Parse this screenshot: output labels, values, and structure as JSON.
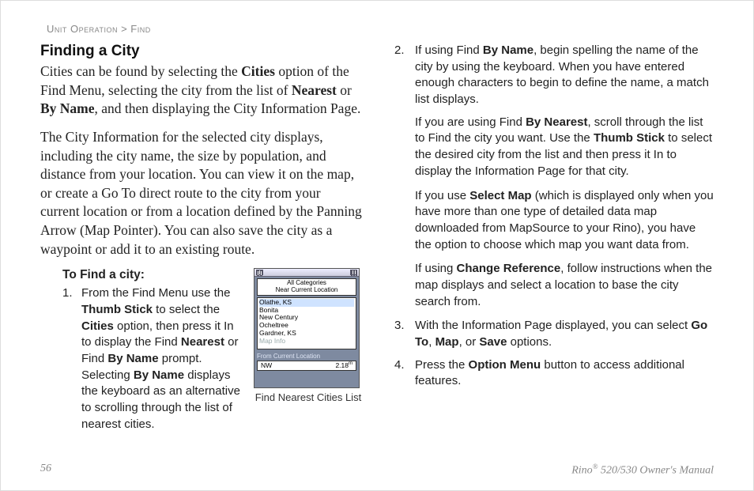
{
  "breadcrumb": {
    "section": "Unit Operation",
    "sep": ">",
    "sub": "Find"
  },
  "left": {
    "title": "Finding a City",
    "p1_a": "Cities can be found by selecting the ",
    "p1_b": "Cities",
    "p1_c": " option of the Find Menu, selecting the city from the list of ",
    "p1_d": "Nearest",
    "p1_e": " or ",
    "p1_f": "By Name",
    "p1_g": ", and then displaying the City Information Page.",
    "p2": "The City Information for the selected city displays, including the city name, the size by population, and distance from your location. You can view it on the map, or create a Go To direct route to the city from your current location or from a location defined by the Panning Arrow (Map Pointer). You can also save the city as a waypoint or add it to an existing route.",
    "steps_title": "To Find a city:",
    "step1_a": "From the Find Menu use the ",
    "step1_b": "Thumb Stick",
    "step1_c": " to select the ",
    "step1_d": "Cities",
    "step1_e": " option, then press it In to display the Find ",
    "step1_f": "Nearest",
    "step1_g": " or Find ",
    "step1_h": "By Name",
    "step1_i": " prompt. Selecting ",
    "step1_j": "By Name",
    "step1_k": " displays the keyboard as an alternative to scrolling through the list of nearest cities."
  },
  "figure": {
    "top_header_l1": "All Categories",
    "top_header_l2": "Near Current Location",
    "list": [
      "Olathe, KS",
      "Bonita",
      "New Century",
      "Ocheltree",
      "Gardner, KS",
      "Map Info"
    ],
    "footer_label": "From Current Location",
    "footer_dir": "NW",
    "footer_dist": "2.18",
    "footer_unit": "m",
    "caption": "Find Nearest Cities List"
  },
  "right": {
    "s2a_a": "If using Find ",
    "s2a_b": "By Name",
    "s2a_c": ", begin spelling the name of the city by using the keyboard. When you have entered enough characters to begin to define the name, a match list displays.",
    "s2b_a": "If you are using Find ",
    "s2b_b": "By Nearest",
    "s2b_c": ", scroll through the list to Find the city you want. Use the ",
    "s2b_d": "Thumb Stick",
    "s2b_e": " to select the desired city from the list and then press it In to display the Information Page for that city.",
    "s2c_a": "If you use ",
    "s2c_b": "Select Map",
    "s2c_c": " (which is displayed only when you have more than one type of detailed data map downloaded from MapSource to your Rino), you have the option to choose which map you want data from.",
    "s2d_a": "If using ",
    "s2d_b": "Change Reference",
    "s2d_c": ", follow instructions when the map displays and select a location to base the city search from.",
    "s3_a": "With the Information Page displayed, you can select ",
    "s3_b": "Go To",
    "s3_c": ", ",
    "s3_d": "Map",
    "s3_e": ", or ",
    "s3_f": "Save",
    "s3_g": " options.",
    "s4_a": "Press the ",
    "s4_b": "Option Menu",
    "s4_c": " button to access additional features."
  },
  "footer": {
    "page": "56",
    "manual_a": "Rino",
    "manual_b": "®",
    "manual_c": " 520/530 Owner's Manual"
  }
}
